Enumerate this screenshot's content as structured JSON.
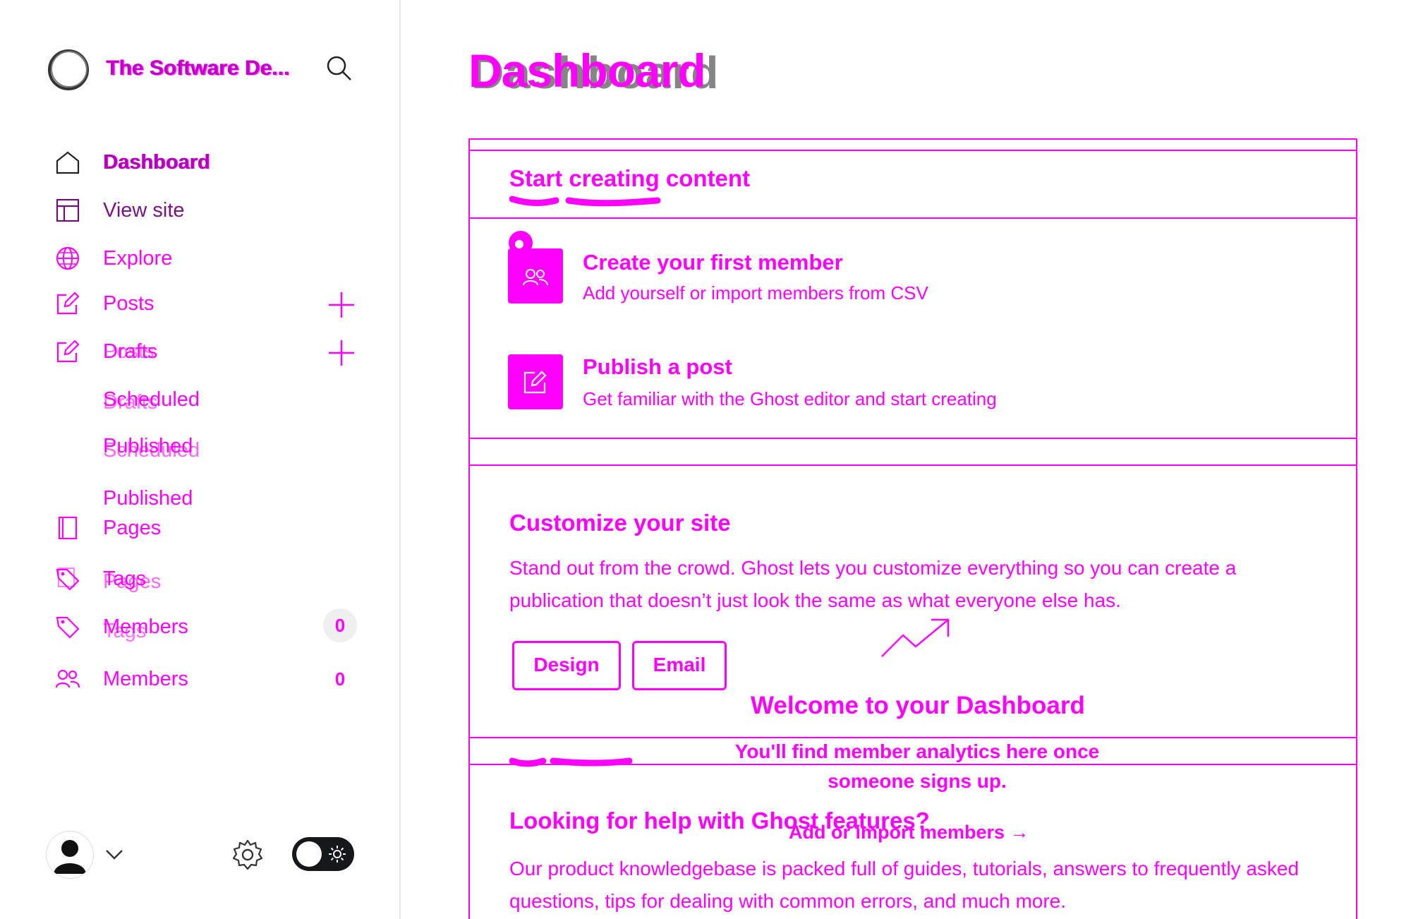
{
  "brand": {
    "title": "The Software De..."
  },
  "nav": {
    "dashboard": "Dashboard",
    "view_site": "View site",
    "explore": "Explore",
    "posts": "Posts",
    "drafts": "Drafts",
    "scheduled": "Scheduled",
    "published": "Published",
    "pages": "Pages",
    "tags": "Tags",
    "members": "Members",
    "members_count": "0"
  },
  "main": {
    "title": "Dashboard",
    "start": {
      "heading": "Start creating content",
      "tasks": [
        {
          "title": "Create your first member",
          "subtitle": "Add yourself or import members from CSV",
          "icon": "members-icon"
        },
        {
          "title": "Publish a post",
          "subtitle": "Get familiar with the Ghost editor and start creating",
          "icon": "edit-icon"
        }
      ]
    },
    "customize": {
      "heading": "Customize your site",
      "text": "Stand out from the crowd. Ghost lets you customize everything so you can create a publication that doesn’t just look the same as what everyone else has.",
      "design_label": "Design",
      "email_label": "Email"
    },
    "welcome": {
      "title": "Welcome to your Dashboard",
      "text": "You'll find member analytics here once someone signs up.",
      "link": "Add or import members →"
    },
    "help": {
      "heading": "Looking for help with Ghost features?",
      "text": "Our product knowledgebase is packed full of guides, tutorials, answers to frequently asked questions, tips for dealing with common errors, and much more."
    }
  },
  "colors": {
    "accent": "#ff00ff",
    "text": "#15171a",
    "badge_bg": "#efefef"
  }
}
